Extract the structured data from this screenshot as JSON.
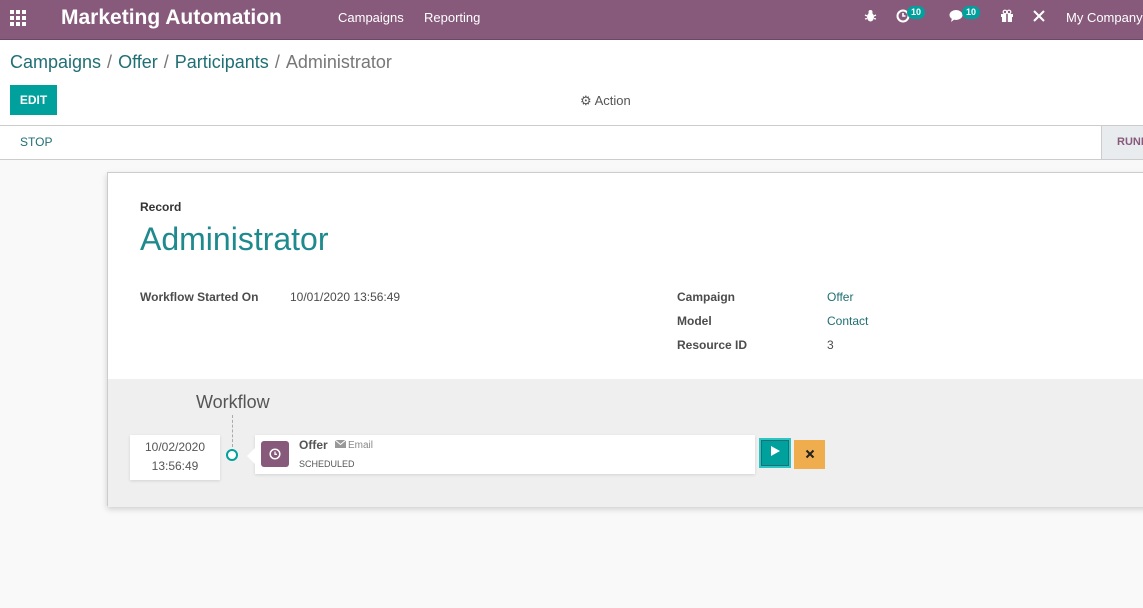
{
  "navbar": {
    "app_title": "Marketing Automation",
    "menus": [
      "Campaigns",
      "Reporting"
    ],
    "activity_count": "10",
    "message_count": "10",
    "company": "My Company",
    "color": "#875a7b"
  },
  "breadcrumb": {
    "items": [
      "Campaigns",
      "Offer",
      "Participants"
    ],
    "current": "Administrator",
    "separator": "/"
  },
  "toolbar": {
    "edit_label": "EDIT",
    "action_label": "Action"
  },
  "statusbar": {
    "stop_label": "STOP",
    "status_label": "RUNNING"
  },
  "record": {
    "label": "Record",
    "title": "Administrator",
    "workflow_started_label": "Workflow Started On",
    "workflow_started_value": "10/01/2020 13:56:49",
    "campaign_label": "Campaign",
    "campaign_value": "Offer",
    "model_label": "Model",
    "model_value": "Contact",
    "resource_label": "Resource ID",
    "resource_value": "3"
  },
  "workflow": {
    "title": "Workflow",
    "activity": {
      "date": "10/02/2020",
      "time": "13:56:49",
      "name": "Offer",
      "type": "Email",
      "state": "SCHEDULED"
    }
  },
  "colors": {
    "accent": "#00a09d",
    "brand": "#875a7b",
    "link": "#1f6f74",
    "cancel": "#f0ad4e"
  }
}
